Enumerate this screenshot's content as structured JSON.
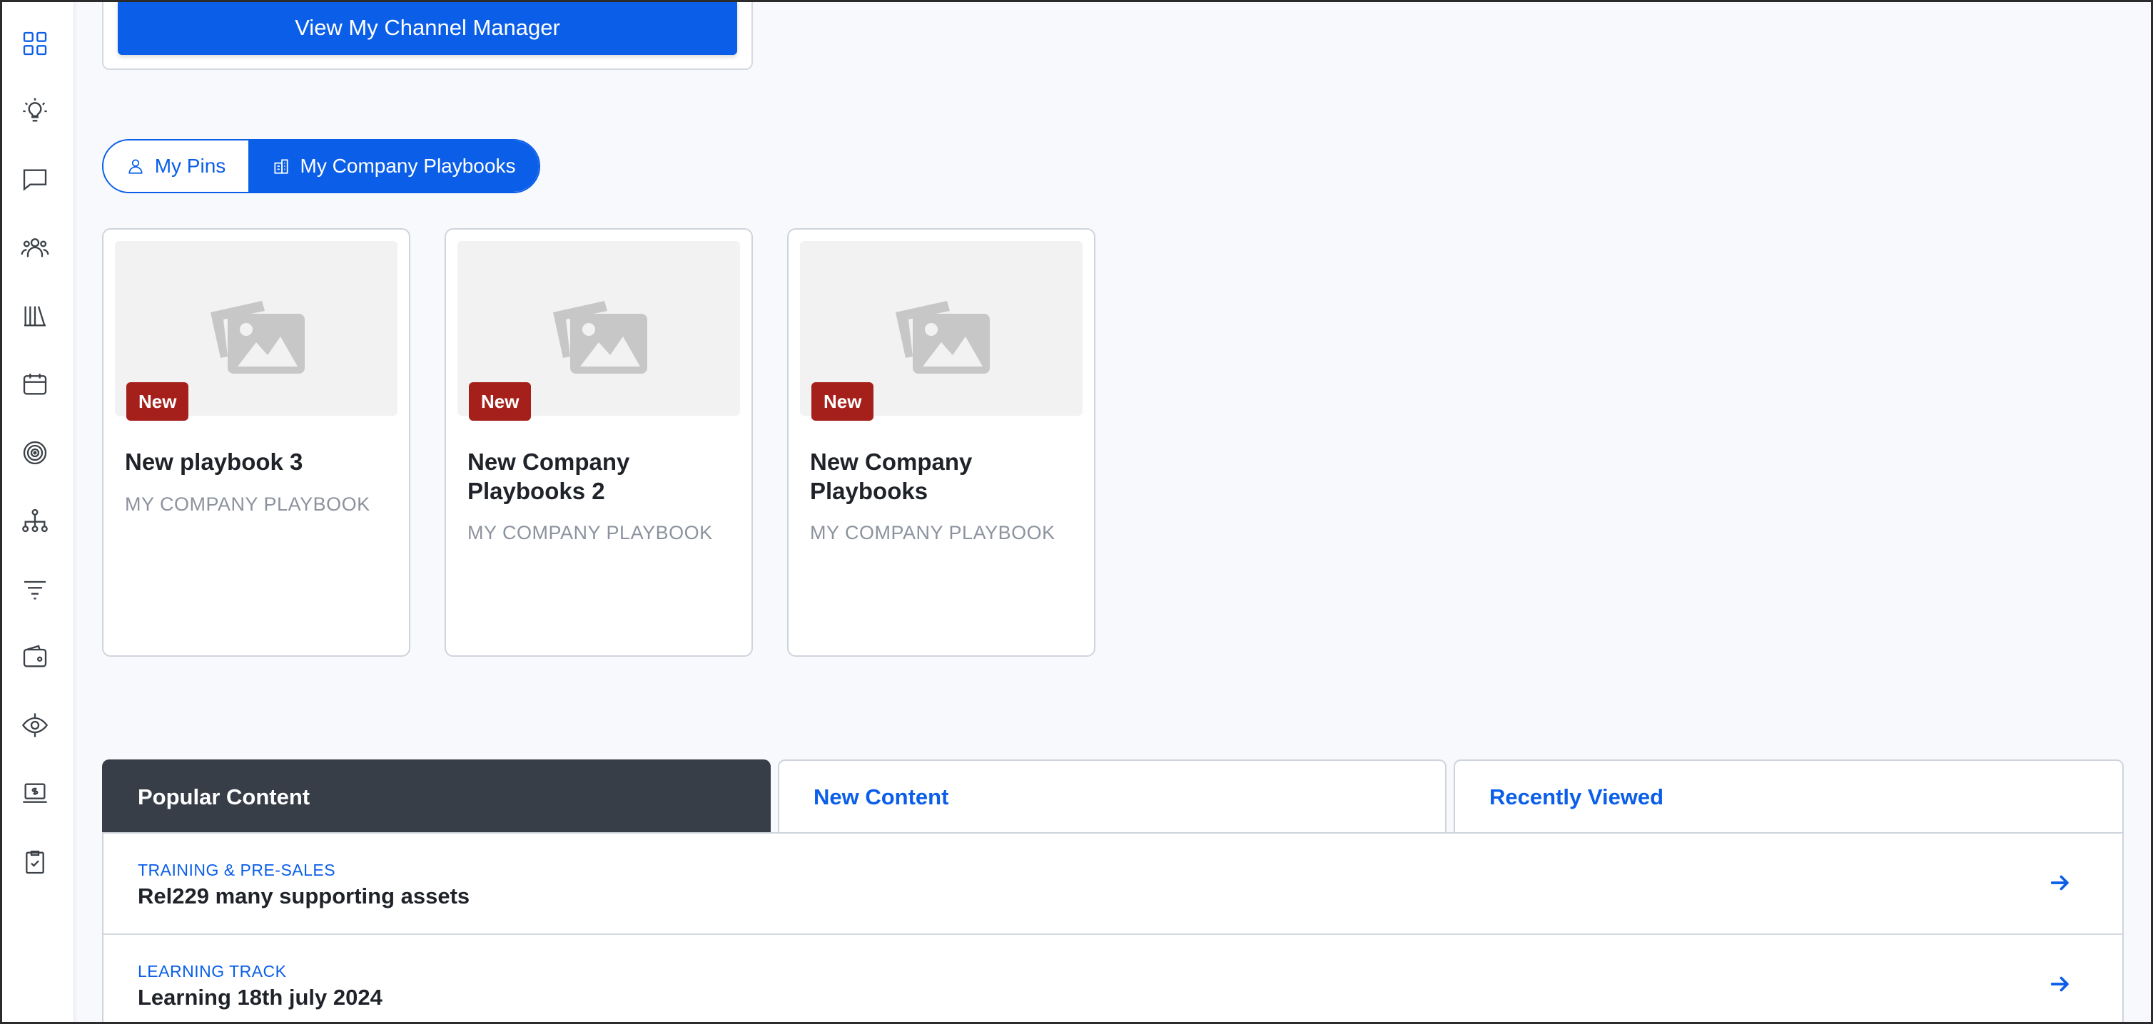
{
  "sidebar": {
    "icons": [
      {
        "name": "dashboard-grid-icon"
      },
      {
        "name": "lightbulb-icon"
      },
      {
        "name": "chat-bubble-icon"
      },
      {
        "name": "users-group-icon"
      },
      {
        "name": "library-books-icon"
      },
      {
        "name": "calendar-icon"
      },
      {
        "name": "target-icon"
      },
      {
        "name": "org-chart-icon"
      },
      {
        "name": "filter-icon"
      },
      {
        "name": "wallet-icon"
      },
      {
        "name": "eye-network-icon"
      },
      {
        "name": "laptop-dollar-icon"
      },
      {
        "name": "clipboard-check-icon"
      }
    ]
  },
  "top_card": {
    "button_label": "View My Channel Manager"
  },
  "toggle": {
    "my_pins": "My Pins",
    "my_company_playbooks": "My Company Playbooks"
  },
  "playbooks": [
    {
      "badge": "New",
      "title": "New playbook 3",
      "subtitle": "MY COMPANY PLAYBOOK"
    },
    {
      "badge": "New",
      "title": "New Company Playbooks 2",
      "subtitle": "MY COMPANY PLAYBOOK"
    },
    {
      "badge": "New",
      "title": "New Company Playbooks",
      "subtitle": "MY COMPANY PLAYBOOK"
    }
  ],
  "content_tabs": {
    "popular": "Popular Content",
    "new": "New Content",
    "recent": "Recently Viewed"
  },
  "content_rows": [
    {
      "category": "TRAINING & PRE-SALES",
      "title": "Rel229 many supporting assets"
    },
    {
      "category": "LEARNING TRACK",
      "title": "Learning 18th july 2024"
    }
  ],
  "colors": {
    "accent": "#0a5ee8",
    "badge": "#a5201b",
    "active_tab": "#383e48"
  }
}
